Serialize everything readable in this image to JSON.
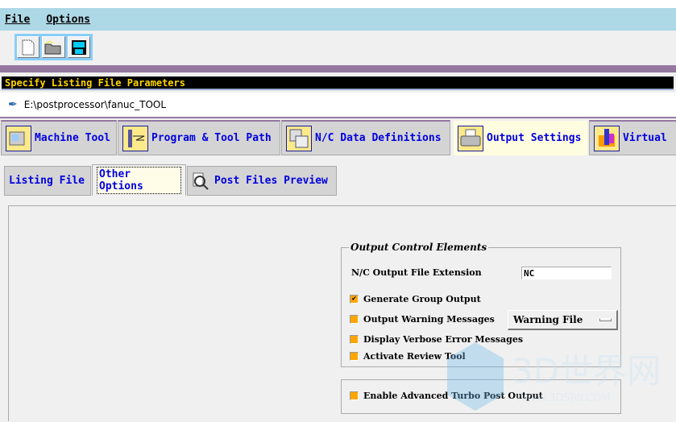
{
  "menu": {
    "file": "File",
    "options": "Options"
  },
  "toolbar": {
    "icons": [
      "new-file-icon",
      "open-folder-icon",
      "save-icon"
    ]
  },
  "status_text": "Specify Listing File Parameters",
  "path": "E:\\postprocessor\\fanuc_TOOL",
  "main_tabs": [
    {
      "label": "Machine Tool",
      "icon": "machine-tool-icon"
    },
    {
      "label": "Program & Tool Path",
      "icon": "tool-path-icon"
    },
    {
      "label": "N/C Data Definitions",
      "icon": "nc-data-icon"
    },
    {
      "label": "Output Settings",
      "icon": "printer-icon",
      "active": true
    },
    {
      "label": "Virtual",
      "icon": "virtual-icon"
    }
  ],
  "sub_tabs": [
    {
      "label": "Listing File"
    },
    {
      "label": "Other Options",
      "active": true
    },
    {
      "label": "Post Files Preview",
      "icon": "magnifier-icon"
    }
  ],
  "group": {
    "title": "Output Control Elements",
    "extension_label": "N/C Output File Extension",
    "extension_value": "NC",
    "checkboxes": [
      {
        "label": "Generate Group Output",
        "checked": true
      },
      {
        "label": "Output Warning Messages",
        "checked": false
      },
      {
        "label": "Display Verbose Error Messages",
        "checked": false
      },
      {
        "label": "Activate Review Tool",
        "checked": false
      }
    ],
    "warning_option": "Warning File"
  },
  "turbo": {
    "label": "Enable Advanced Turbo Post Output",
    "checked": false
  },
  "watermark": {
    "text": "3D世界网",
    "url": "WWW.3DSJW.COM"
  },
  "colors": {
    "menubar": "#add8e6",
    "status_bg": "#000000",
    "status_fg": "#ffd700",
    "tab_text": "#0000e0",
    "checkbox": "#ffa500"
  }
}
